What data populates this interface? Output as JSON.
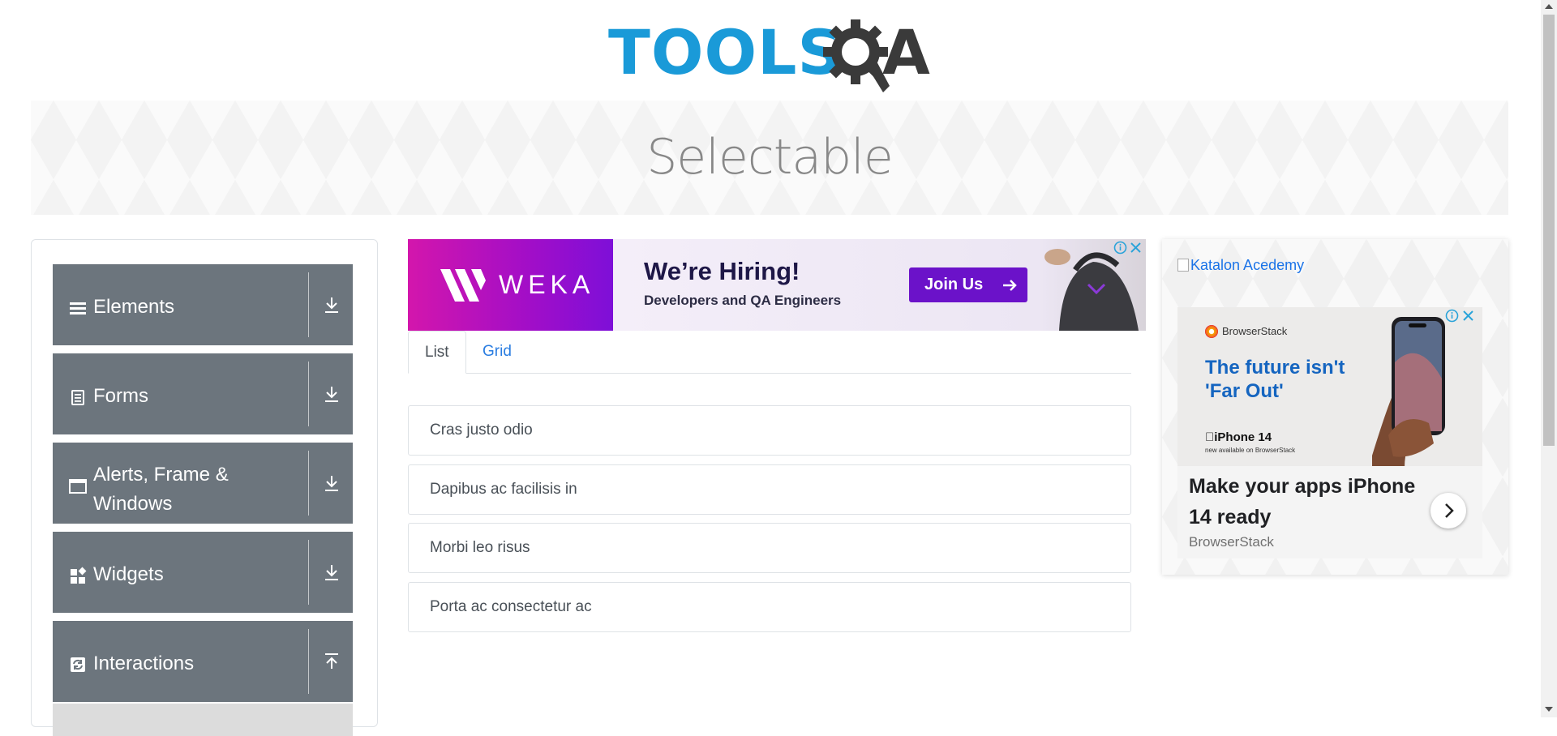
{
  "header": {
    "logo_part1": "TOOLS",
    "logo_part2": "A"
  },
  "banner": {
    "title": "Selectable"
  },
  "sidebar": {
    "groups": [
      {
        "label": "Elements",
        "icon": "menu-lines-icon",
        "arrow": "download"
      },
      {
        "label": "Forms",
        "icon": "document-icon",
        "arrow": "download"
      },
      {
        "label": "Alerts, Frame & Windows",
        "icon": "window-icon",
        "arrow": "download"
      },
      {
        "label": "Widgets",
        "icon": "widgets-icon",
        "arrow": "download"
      },
      {
        "label": "Interactions",
        "icon": "sync-icon",
        "arrow": "upload"
      }
    ]
  },
  "ad_top": {
    "brand": "WEKA",
    "headline": "We’re Hiring!",
    "subline": "Developers and QA Engineers",
    "cta": "Join Us"
  },
  "tabs": [
    {
      "label": "List",
      "active": true
    },
    {
      "label": "Grid",
      "active": false
    }
  ],
  "list_items": [
    "Cras justo odio",
    "Dapibus ac facilisis in",
    "Morbi leo risus",
    "Porta ac consectetur ac"
  ],
  "ad_right": {
    "broken_image_alt": "Katalon Acedemy",
    "card": {
      "brand": "BrowserStack",
      "headline": "The future isn't 'Far Out'",
      "product": "iPhone 14",
      "availability": "new available on BrowserStack",
      "title": "Make your apps iPhone 14 ready",
      "advertiser": "BrowserStack"
    }
  },
  "colors": {
    "sidebar_group_bg": "#6c757d",
    "link_blue": "#2a7de1",
    "logo_blue": "#1a9ad8",
    "logo_dark": "#3a3a3a",
    "weka_purple": "#6b12c9"
  }
}
